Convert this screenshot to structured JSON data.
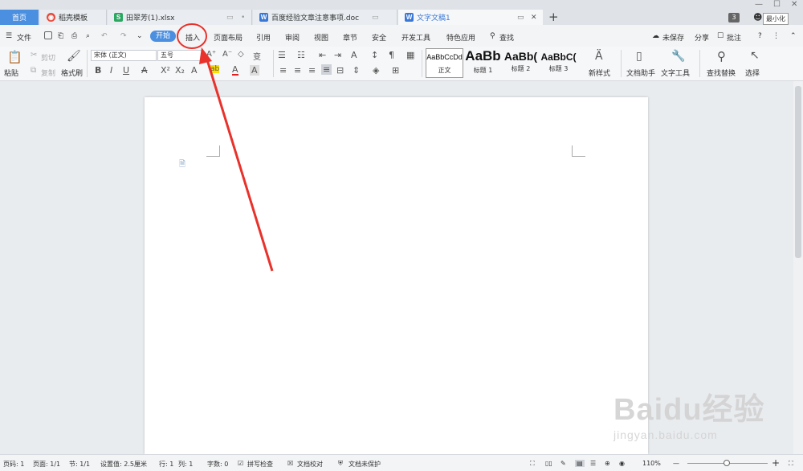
{
  "tabs": {
    "home": "首页",
    "template": "稻壳模板",
    "xlsx": "田翠芳(1).xlsx",
    "doc": "百度经验文章注意事项.doc",
    "active": "文字文稿1"
  },
  "window": {
    "badge": "3",
    "tooltip": "最小化"
  },
  "menu": {
    "file": "文件",
    "start": "开始",
    "items": [
      "插入",
      "页面布局",
      "引用",
      "审阅",
      "视图",
      "章节",
      "安全",
      "开发工具",
      "特色应用"
    ],
    "search": "查找",
    "unsaved": "未保存",
    "share": "分享",
    "comment": "批注",
    "help": "?"
  },
  "ribbon": {
    "paste": "粘贴",
    "cut": "剪切",
    "copy": "复制",
    "format_painter": "格式刷",
    "font": "宋体 (正文)",
    "size": "五号",
    "styles": [
      {
        "sample": "AaBbCcDd",
        "label": "正文"
      },
      {
        "sample": "AaBb",
        "label": "标题 1"
      },
      {
        "sample": "AaBb(",
        "label": "标题 2"
      },
      {
        "sample": "AaBbC(",
        "label": "标题 3"
      }
    ],
    "new_style": "新样式",
    "doc_helper": "文档助手",
    "text_tools": "文字工具",
    "find_replace": "查找替换",
    "select": "选择"
  },
  "watermark": {
    "big": "Baidu经验",
    "small": "jingyan.baidu.com"
  },
  "status": {
    "page_no": "页码: 1",
    "pages": "页面: 1/1",
    "section": "节: 1/1",
    "setting": "设置值: 2.5厘米",
    "row": "行: 1",
    "col": "列: 1",
    "words": "字数: 0",
    "spell": "拼写检查",
    "proof": "文档校对",
    "protect": "文档未保护",
    "zoom": "110%"
  },
  "colors": {
    "accent": "#4b8fe0",
    "annotation": "#e8322b"
  }
}
